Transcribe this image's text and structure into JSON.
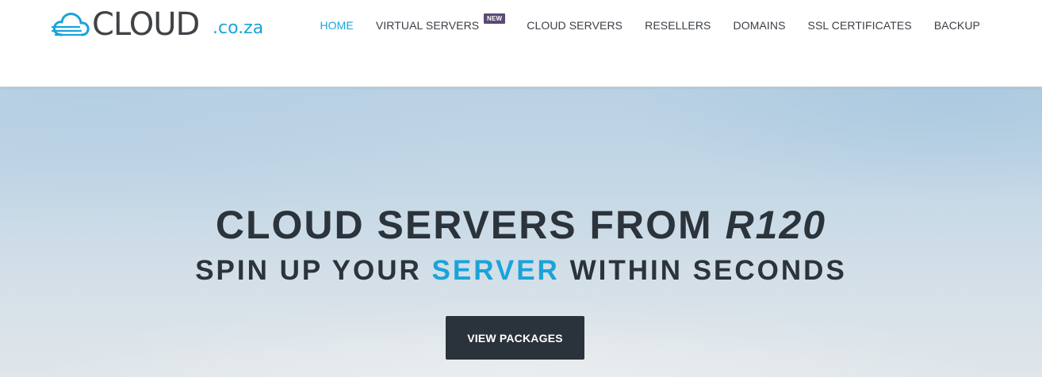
{
  "brand": {
    "name": "CLOUD",
    "tld": ".co.za",
    "accent_color": "#1aa3d9",
    "dark_color": "#2b333b"
  },
  "nav": {
    "items": [
      {
        "label": "HOME",
        "active": true
      },
      {
        "label": "VIRTUAL SERVERS",
        "badge": "NEW"
      },
      {
        "label": "CLOUD SERVERS"
      },
      {
        "label": "RESELLERS"
      },
      {
        "label": "DOMAINS"
      },
      {
        "label": "SSL CERTIFICATES"
      },
      {
        "label": "BACKUP"
      }
    ]
  },
  "hero": {
    "title_prefix": "CLOUD SERVERS FROM ",
    "title_price": "R120",
    "subtitle_prefix": "SPIN UP YOUR ",
    "subtitle_highlight": "SERVER",
    "subtitle_suffix": " WITHIN SECONDS",
    "cta_label": "VIEW PACKAGES"
  }
}
